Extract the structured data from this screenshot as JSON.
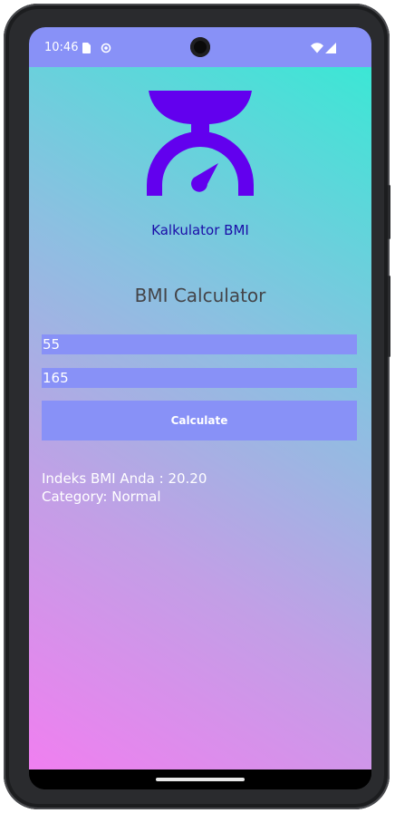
{
  "status_bar": {
    "time": "10:46",
    "left_icons": [
      "sim-card-icon",
      "sync-icon"
    ],
    "right_icons": [
      "wifi-icon",
      "signal-icon"
    ]
  },
  "app": {
    "logo_icon": "weighing-scale-icon",
    "logo_color": "#6200ee",
    "label": "Kalkulator BMI",
    "title": "BMI Calculator",
    "weight_input": {
      "value": "55"
    },
    "height_input": {
      "value": "165"
    },
    "calculate_label": "Calculate",
    "result_index": "Indeks BMI Anda : 20.20",
    "result_category": "Category: Normal"
  },
  "colors": {
    "status_bar": "#8891f7",
    "accent": "#8891f7",
    "label_text": "#1b0ea8",
    "gradient_top": "#3be7d5",
    "gradient_bottom": "#f07ff0"
  }
}
